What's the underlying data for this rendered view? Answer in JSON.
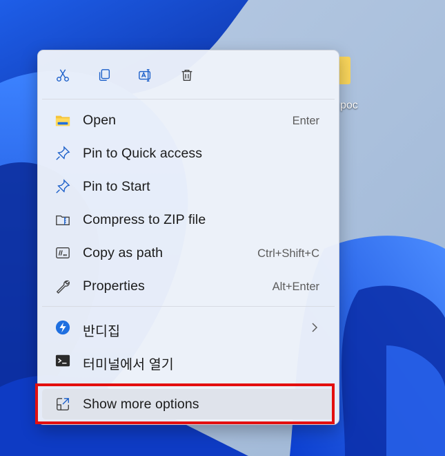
{
  "desktop": {
    "folder_label": "poc",
    "accent_color": "#0f62d8",
    "annotation_color": "#e30f0f"
  },
  "quick_actions": [
    {
      "icon": "scissors-icon",
      "action": "cut"
    },
    {
      "icon": "copy-icon",
      "action": "copy"
    },
    {
      "icon": "rename-icon",
      "action": "rename"
    },
    {
      "icon": "trash-icon",
      "action": "delete"
    }
  ],
  "menu": {
    "items": [
      {
        "label": "Open",
        "shortcut": "Enter",
        "icon": "folder-icon"
      },
      {
        "label": "Pin to Quick access",
        "shortcut": "",
        "icon": "pin-icon"
      },
      {
        "label": "Pin to Start",
        "shortcut": "",
        "icon": "pin-icon"
      },
      {
        "label": "Compress to ZIP file",
        "shortcut": "",
        "icon": "zip-icon"
      },
      {
        "label": "Copy as path",
        "shortcut": "Ctrl+Shift+C",
        "icon": "copy-path-icon"
      },
      {
        "label": "Properties",
        "shortcut": "Alt+Enter",
        "icon": "wrench-icon"
      }
    ],
    "extensions": [
      {
        "label": "반디집",
        "icon": "bandizip-icon",
        "has_submenu": true
      },
      {
        "label": "터미널에서 열기",
        "icon": "terminal-icon",
        "has_submenu": false
      }
    ],
    "more": {
      "label": "Show more options",
      "icon": "show-more-icon"
    }
  }
}
